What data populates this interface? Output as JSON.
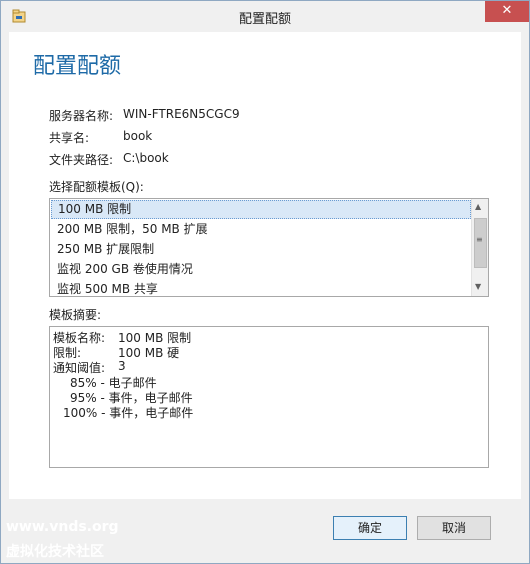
{
  "window": {
    "title": "配置配额",
    "close_glyph": "✕"
  },
  "dialog": {
    "heading": "配置配额"
  },
  "fields": [
    {
      "label": "服务器名称:",
      "value": "WIN-FTRE6N5CGC9"
    },
    {
      "label": "共享名:",
      "value": "book"
    },
    {
      "label": "文件夹路径:",
      "value": "C:\\book"
    }
  ],
  "template_list": {
    "label": "选择配额模板(Q):",
    "items": [
      "100 MB 限制",
      "200 MB 限制，50 MB 扩展",
      "250 MB 扩展限制",
      "监视 200 GB 卷使用情况",
      "监视 500 MB 共享"
    ],
    "selected_index": 0
  },
  "summary": {
    "label": "模板摘要:",
    "lines": [
      {
        "key": "模板名称:",
        "value": "100 MB 限制"
      },
      {
        "key": "限制:",
        "value": "100 MB 硬"
      },
      {
        "key": "通知阈值:",
        "value": "3"
      }
    ],
    "thresholds": [
      "85% - 电子邮件",
      "95% - 事件，电子邮件",
      "100% - 事件，电子邮件"
    ]
  },
  "buttons": {
    "ok": "确定",
    "cancel": "取消"
  },
  "watermark": {
    "line1": "www.vnds.org",
    "line2": "虚拟化技术社区"
  },
  "icons": {
    "app": "folder-quota-icon",
    "scroll_up": "▲",
    "scroll_down": "▼",
    "grip": "≡"
  },
  "colors": {
    "heading": "#1e6aa7",
    "close": "#c75050",
    "selection": "#d9e8f7"
  }
}
